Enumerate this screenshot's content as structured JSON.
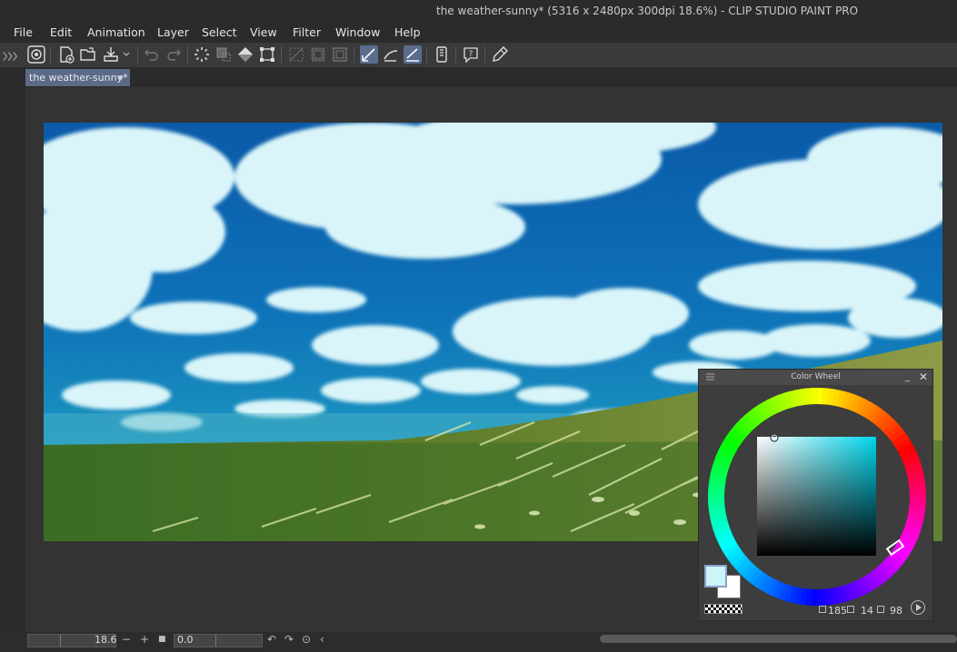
{
  "window": {
    "title": "the weather-sunny* (5316 x 2480px 300dpi 18.6%)  - CLIP STUDIO PAINT PRO"
  },
  "menu": [
    "File",
    "Edit",
    "Animation",
    "Layer",
    "Select",
    "View",
    "Filter",
    "Window",
    "Help"
  ],
  "toolbar": {
    "icons": [
      "collapse-chevrons-icon",
      "clip-studio-icon",
      "new-canvas-icon",
      "open-folder-icon",
      "save-export-icon",
      "undo-icon",
      "redo-icon",
      "loading-spinner-icon",
      "transform-selection-icon",
      "fill-icon",
      "free-transform-icon",
      "deselect-icon",
      "invert-selection-icon",
      "selection-border-icon",
      "snap-ruler-icon",
      "snap-special-ruler-icon",
      "snap-grid-icon",
      "device-settings-icon",
      "help-icon",
      "eyedropper-pen-icon"
    ],
    "active": [
      "snap-ruler-icon",
      "snap-grid-icon"
    ]
  },
  "document_tab": {
    "label": "the weather-sunny*"
  },
  "color_wheel": {
    "title": "Color Wheel",
    "main_color": "#cbf5f8",
    "sub_color": "#ffffff",
    "hue": "185",
    "saturation": "14",
    "value": "98"
  },
  "status_bar": {
    "zoom": "18.6",
    "rotation": "0.0"
  },
  "colors": {
    "sky_deep": "#0a64b4",
    "sky_mid": "#127ec2",
    "cloud": "#d8f5f8",
    "grass_dark": "#3c6a24",
    "grass_light": "#9ba04a"
  }
}
